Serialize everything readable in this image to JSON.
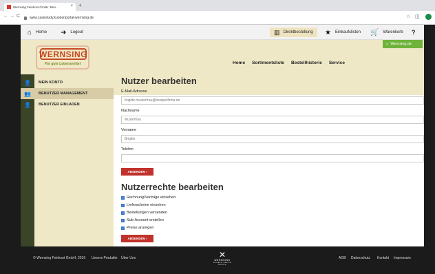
{
  "browser": {
    "tab_title": "Wernsing Feinkost GmbH: Ben...",
    "tab_close": "×",
    "new_tab": "+",
    "back": "←",
    "forward": "→",
    "reload": "C",
    "url": "www.casestudy.kundenportal-wernsing.de",
    "star": "☆",
    "ext": "◫"
  },
  "topbar": {
    "home_label": "Home",
    "logout_label": "Logout",
    "direktbestellung_label": "Direktbestellung",
    "einkaufslisten_label": "Einkaufslisten",
    "warenkorb_label": "Warenkorb",
    "help_icon": "?"
  },
  "header": {
    "logo_text": "WERNSING",
    "logo_tagline": "Für gute Lebensmittel",
    "nav": [
      "Home",
      "Sortimentsliste",
      "Bestellhistorie",
      "Service"
    ],
    "wernsing_de_label": "Wernsing.de"
  },
  "sidebar": {
    "items": [
      {
        "label": "MEIN KONTO"
      },
      {
        "label": "BENUTZER MANAGEMENT"
      },
      {
        "label": "BENUTZER EINLADEN"
      }
    ]
  },
  "form": {
    "title": "Nutzer bearbeiten",
    "email_label": "E-Mail-Adresse",
    "email_value": "brigitte.musterfrau@beispielfirma.de",
    "nachname_label": "Nachname",
    "nachname_value": "Musterfrau",
    "vorname_label": "Vorname",
    "vorname_value": "Brigitte",
    "telefon_label": "Telefon",
    "telefon_value": "",
    "submit_label": "ABSENDEN  ›"
  },
  "rights": {
    "title": "Nutzerrechte bearbeiten",
    "items": [
      {
        "label": "Rechnung/Verträge einsehen",
        "checked": true
      },
      {
        "label": "Lieferscheine einsehen",
        "checked": true
      },
      {
        "label": "Bestellungen versenden",
        "checked": true
      },
      {
        "label": "Sub-Account erstellen",
        "checked": true
      },
      {
        "label": "Preise anzeigen",
        "checked": true
      }
    ],
    "submit_label": "ABSENDEN  ›"
  },
  "footer": {
    "copyright": "© Wernsing Feinkost GmbH, 2019",
    "links_left": [
      "Unsere Produkte",
      "Über Uns"
    ],
    "links_right": [
      "AGB",
      "Datenschutz",
      "Kontakt",
      "Impressum"
    ],
    "logo_name": "WERNSING",
    "logo_sub": "Feinkost Food & Service"
  },
  "colors": {
    "accent_red": "#c0322b",
    "brand_cream": "#efe8c6",
    "green": "#6fb33a",
    "checkbox_blue": "#3a6fc9"
  }
}
